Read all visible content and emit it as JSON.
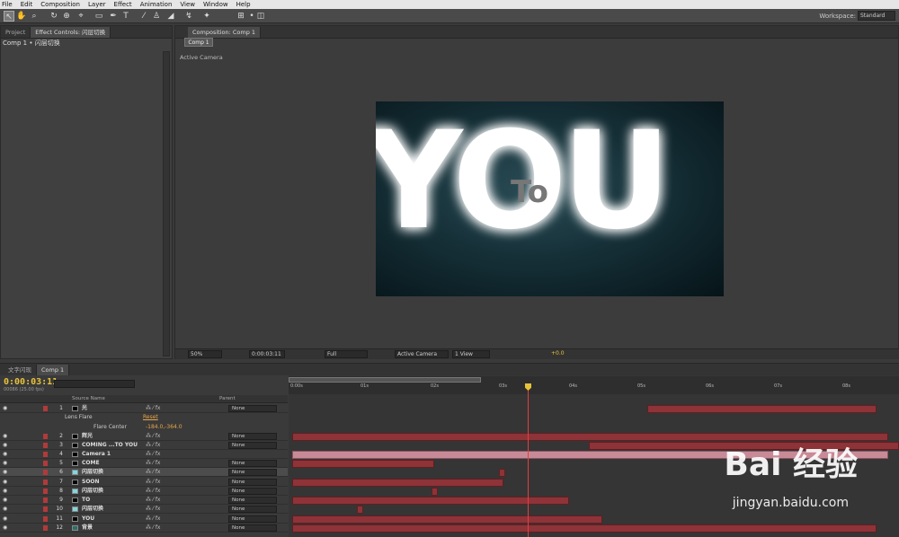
{
  "menu": [
    "File",
    "Edit",
    "Composition",
    "Layer",
    "Effect",
    "Animation",
    "View",
    "Window",
    "Help"
  ],
  "workspace": {
    "label": "Workspace:",
    "value": "Standard"
  },
  "left_panel": {
    "tabs": [
      "Project",
      "Effect Controls: 闪层切换"
    ],
    "subtitle": "Comp 1 • 闪层切换"
  },
  "comp_panel": {
    "tab": "Composition: Comp 1",
    "subtab": "Comp 1",
    "view_label": "Active Camera",
    "viewer_text": {
      "big": "YOU",
      "small": "To"
    },
    "footer": {
      "zoom": "50%",
      "timecode": "0:00:03:11",
      "resolution": "Full",
      "camera": "Active Camera",
      "views": "1 View",
      "offset": "+0.0"
    }
  },
  "timeline": {
    "tabs": [
      "文字闪现",
      "Comp 1"
    ],
    "timecode": "0:00:03:11",
    "fps": "00086 (25.00 fps)",
    "columns": {
      "source": "Source Name",
      "parent": "Parent"
    },
    "ruler": [
      "0:00s",
      "01s",
      "02s",
      "03s",
      "04s",
      "05s",
      "06s",
      "07s",
      "08s"
    ],
    "effect_row": {
      "name": "Lens Flare",
      "reset": "Reset",
      "sub": "Flare Center",
      "value": "-184.0,-364.0"
    },
    "layers": [
      {
        "num": "1",
        "name": "光",
        "color": "#000000",
        "parent": "None"
      },
      {
        "num": "2",
        "name": "辉光",
        "color": "#000000",
        "parent": "None"
      },
      {
        "num": "3",
        "name": "COMING ...TO YOU",
        "color": "#000000",
        "parent": "None"
      },
      {
        "num": "4",
        "name": "Camera 1",
        "color": "#000000",
        "parent": ""
      },
      {
        "num": "5",
        "name": "COME",
        "color": "#000000",
        "parent": "None"
      },
      {
        "num": "6",
        "name": "闪层切换",
        "color": "#7fd8e0",
        "parent": "None"
      },
      {
        "num": "7",
        "name": "SOON",
        "color": "#000000",
        "parent": "None"
      },
      {
        "num": "8",
        "name": "闪层切换",
        "color": "#7fd8e0",
        "parent": "None"
      },
      {
        "num": "9",
        "name": "TO",
        "color": "#000000",
        "parent": "None"
      },
      {
        "num": "10",
        "name": "闪层切换",
        "color": "#7fd8e0",
        "parent": "None"
      },
      {
        "num": "11",
        "name": "YOU",
        "color": "#000000",
        "parent": "None"
      },
      {
        "num": "12",
        "name": "背景",
        "color": "#2b6e6a",
        "parent": "None"
      }
    ]
  },
  "watermark": {
    "brand": "Bai 经验",
    "url": "jingyan.baidu.com"
  }
}
